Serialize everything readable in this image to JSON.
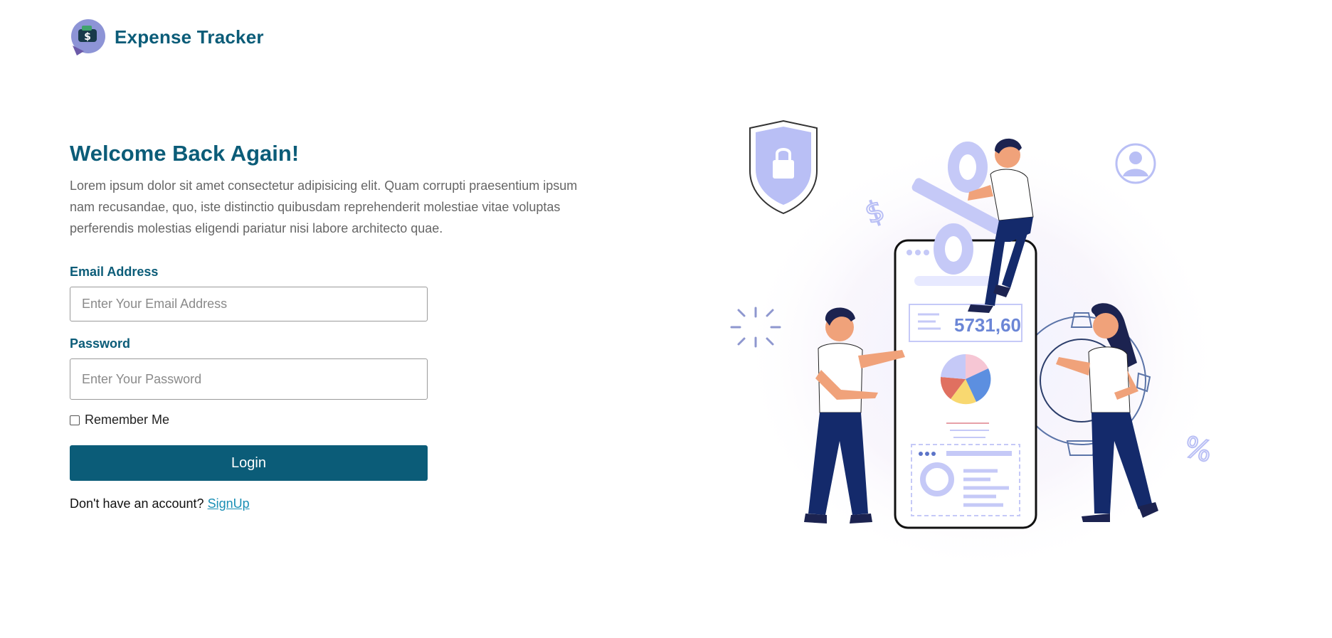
{
  "brand": {
    "name": "Expense Tracker",
    "logo_icon": "wallet-dollar-icon"
  },
  "login": {
    "title": "Welcome Back Again!",
    "description": "Lorem ipsum dolor sit amet consectetur adipisicing elit. Quam corrupti praesentium ipsum nam recusandae, quo, iste distinctio quibusdam reprehenderit molestiae vitae voluptas perferendis molestias eligendi pariatur nisi labore architecto quae.",
    "email_label": "Email Address",
    "email_placeholder": "Enter Your Email Address",
    "email_value": "",
    "password_label": "Password",
    "password_placeholder": "Enter Your Password",
    "password_value": "",
    "remember_label": "Remember Me",
    "remember_checked": false,
    "submit_label": "Login",
    "signup_prompt": "Don't have an account?",
    "signup_link": "SignUp"
  },
  "illustration": {
    "amount": "5731,60",
    "percent_symbol": "%",
    "dollar_symbol": "$",
    "icons": [
      "shield-lock-icon",
      "user-circle-icon",
      "dollar-icon",
      "percent-icon",
      "gear-icon",
      "pie-chart-icon",
      "sparkle-icon"
    ]
  },
  "colors": {
    "primary": "#0b5c78",
    "link": "#1a8fb5",
    "text_muted": "#666666",
    "navy": "#142a6b",
    "lavender": "#c5c9f7"
  }
}
